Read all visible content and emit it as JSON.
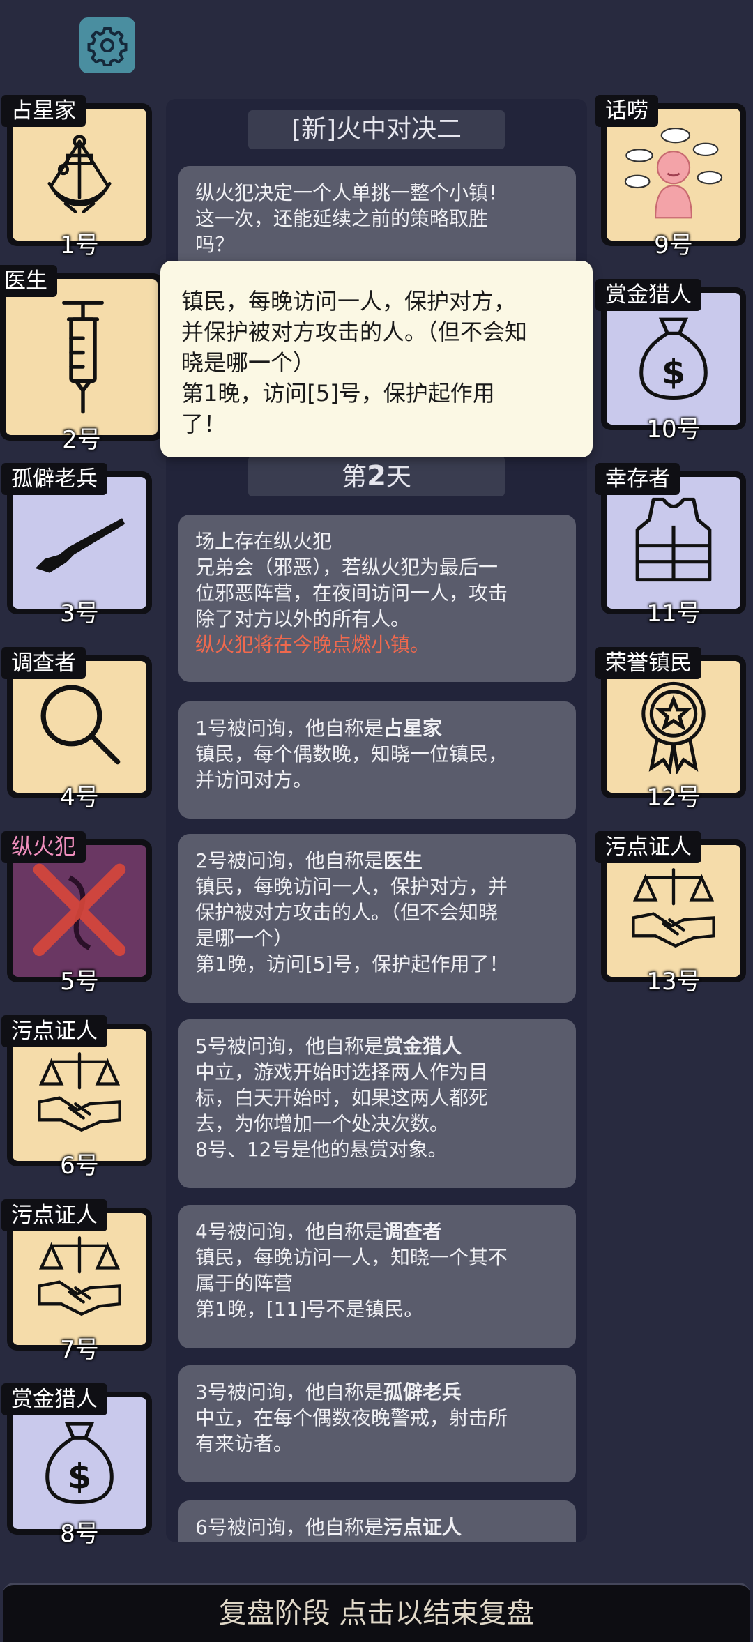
{
  "header": {
    "settings_icon": "gear-icon"
  },
  "panel": {
    "title": "[新]火中对决二",
    "day_prefix": "第",
    "day_number": "2",
    "day_suffix": "天"
  },
  "tooltip": {
    "line1": "镇民，每晚访问一人，保护对方，",
    "line2": "并保护被对方攻击的人。（但不会知",
    "line3": "晓是哪一个）",
    "line4": "第1晚，访问[5]号，保护起作用",
    "line5": "了！"
  },
  "messages": {
    "intro": {
      "l1": "纵火犯决定一个人单挑一整个小镇！",
      "l2": "这一次，还能延续之前的策略取胜",
      "l3": "吗？"
    },
    "m1": {
      "l1": "场上存在纵火犯",
      "l2": "兄弟会（邪恶），若纵火犯为最后一",
      "l3": "位邪恶阵营，在夜间访问一人，攻击",
      "l4": "除了对方以外的所有人。",
      "l5": "纵火犯将在今晚点燃小镇。"
    },
    "m2": {
      "pre": "1号被问询，他自称是",
      "claim": "占星家",
      "l2": "镇民，每个偶数晚，知晓一位镇民，",
      "l3": "并访问对方。"
    },
    "m3": {
      "pre": "2号被问询，他自称是",
      "claim": "医生",
      "l2": "镇民，每晚访问一人，保护对方，并",
      "l3": "保护被对方攻击的人。（但不会知晓",
      "l4": "是哪一个）",
      "l5": "第1晚，访问[5]号，保护起作用了！"
    },
    "m4": {
      "pre": "5号被问询，他自称是",
      "claim": "赏金猎人",
      "l2": "中立，游戏开始时选择两人作为目",
      "l3": "标，白天开始时，如果这两人都死",
      "l4": "去，为你增加一个处决次数。",
      "l5": "8号、12号是他的悬赏对象。"
    },
    "m5": {
      "pre": "4号被问询，他自称是",
      "claim": "调查者",
      "l2": "镇民，每晚访问一人，知晓一个其不",
      "l3": "属于的阵营",
      "l4": "第1晚，[11]号不是镇民。"
    },
    "m6": {
      "pre": "3号被问询，他自称是",
      "claim": "孤僻老兵",
      "l2": "中立，在每个偶数夜晚警戒，射击所",
      "l3": "有来访者。"
    },
    "m7": {
      "pre": "6号被问询，他自称是",
      "claim": "污点证人"
    }
  },
  "players": {
    "p1": {
      "role": "占星家",
      "number": "1号",
      "icon": "sextant-icon"
    },
    "p2": {
      "role": "医生",
      "number": "2号",
      "icon": "syringe-icon"
    },
    "p3": {
      "role": "孤僻老兵",
      "number": "3号",
      "icon": "rifle-icon"
    },
    "p4": {
      "role": "调查者",
      "number": "4号",
      "icon": "magnifier-icon"
    },
    "p5": {
      "role": "纵火犯",
      "number": "5号",
      "icon": "burned-dead-icon"
    },
    "p6": {
      "role": "污点证人",
      "number": "6号",
      "icon": "scales-handshake-icon"
    },
    "p7": {
      "role": "污点证人",
      "number": "7号",
      "icon": "scales-handshake-icon"
    },
    "p8": {
      "role": "赏金猎人",
      "number": "8号",
      "icon": "money-bag-icon"
    },
    "p9": {
      "role": "话唠",
      "number": "9号",
      "icon": "chatter-icon"
    },
    "p10": {
      "role": "赏金猎人",
      "number": "10号",
      "icon": "money-bag-icon"
    },
    "p11": {
      "role": "幸存者",
      "number": "11号",
      "icon": "vest-icon"
    },
    "p12": {
      "role": "荣誉镇民",
      "number": "12号",
      "icon": "medal-icon"
    },
    "p13": {
      "role": "污点证人",
      "number": "13号",
      "icon": "scales-handshake-icon"
    }
  },
  "bottom_bar": {
    "label": "复盘阶段 点击以结束复盘"
  },
  "colors": {
    "background": "#282a3f",
    "card_yellow": "#f5dcaa",
    "card_purple": "#c9c9ec",
    "evil_text": "#f08fbd",
    "warning_text": "#f0694e",
    "settings_button": "#4a8ea0"
  }
}
